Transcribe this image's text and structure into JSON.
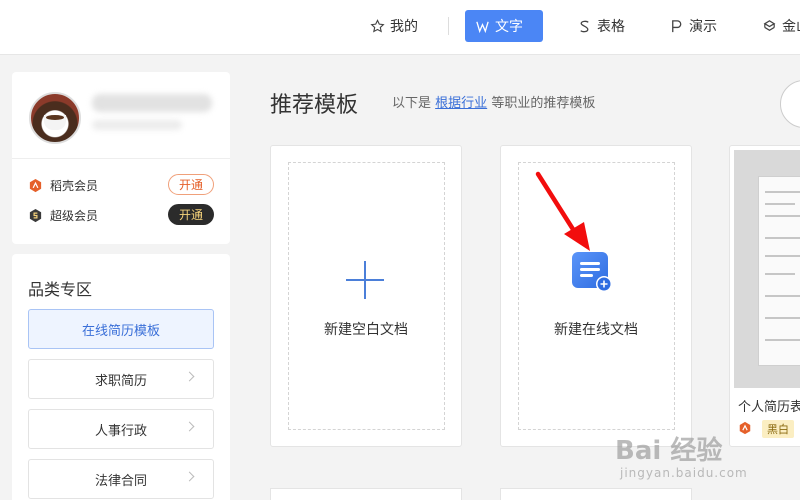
{
  "nav": {
    "items": [
      {
        "label": "我的",
        "icon": "star-icon"
      },
      {
        "label": "文字",
        "icon": "word-icon"
      },
      {
        "label": "表格",
        "icon": "sheet-icon"
      },
      {
        "label": "演示",
        "icon": "slide-icon"
      },
      {
        "label": "金山",
        "icon": "kingsoft-icon"
      }
    ],
    "accent": "#4b86f5"
  },
  "profile": {
    "vips": [
      {
        "name": "稻壳会员",
        "action": "开通",
        "icon_color": "#e5602a"
      },
      {
        "name": "超级会员",
        "action": "开通",
        "icon_color": "#3a3a3a"
      }
    ]
  },
  "category": {
    "title": "品类专区",
    "items": [
      "在线简历模板",
      "求职简历",
      "人事行政",
      "法律合同"
    ]
  },
  "main": {
    "title": "推荐模板",
    "subtitle_prefix": "以下是",
    "subtitle_link": "根据行业",
    "subtitle_suffix": "等职业的推荐模板",
    "cards": [
      {
        "label": "新建空白文档",
        "icon": "plus-icon"
      },
      {
        "label": "新建在线文档",
        "icon": "online-doc-icon"
      }
    ],
    "preview": {
      "title": "个人简历表",
      "tag": "黑白"
    }
  },
  "watermark": {
    "brand": "Bai 经验",
    "url": "jingyan.baidu.com"
  }
}
